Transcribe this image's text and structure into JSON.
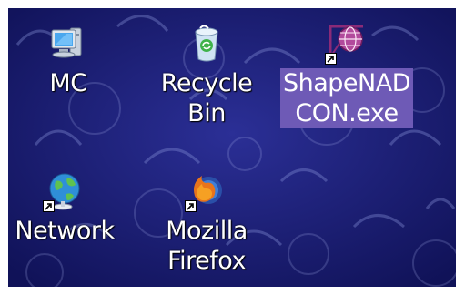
{
  "desktop": {
    "icons": [
      {
        "label": "MC",
        "icon": "computer-icon",
        "shortcut": false,
        "selected": false
      },
      {
        "label": "Recycle Bin",
        "line1": "Recycle",
        "line2": "Bin",
        "icon": "recycle-bin-icon",
        "shortcut": false,
        "selected": false
      },
      {
        "label": "ShapeNADCON.exe",
        "line1": "ShapeNAD",
        "line2": "CON.exe",
        "icon": "shapenadcon-app-icon",
        "shortcut": true,
        "selected": true
      },
      {
        "label": "Network",
        "icon": "network-icon",
        "shortcut": true,
        "selected": false
      },
      {
        "label": "Mozilla Firefox",
        "line1": "Mozilla",
        "line2": "Firefox",
        "icon": "firefox-icon",
        "shortcut": true,
        "selected": false
      }
    ]
  },
  "colors": {
    "desktop_background": "#16186a",
    "selection_highlight": "#6e5ab6",
    "label_text": "#ffffff"
  }
}
